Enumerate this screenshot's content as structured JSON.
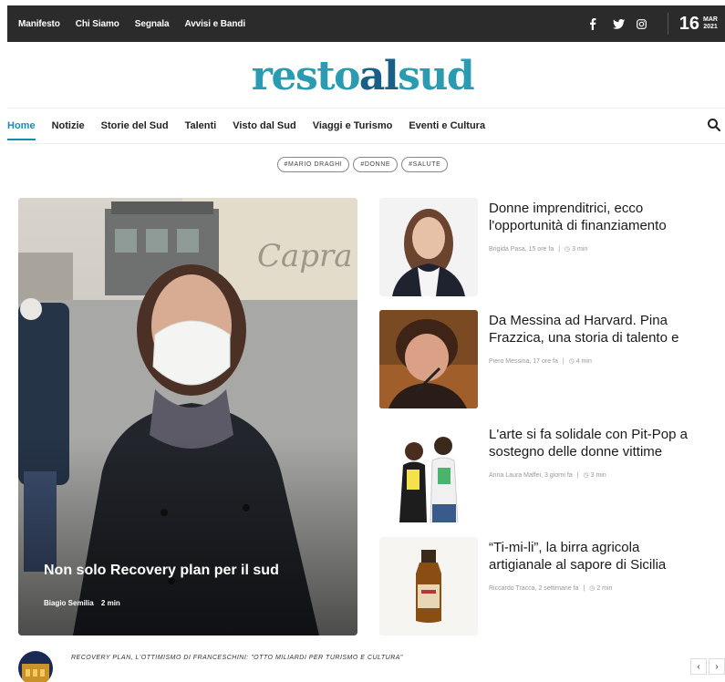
{
  "topbar": {
    "links": [
      "Manifesto",
      "Chi Siamo",
      "Segnala",
      "Avvisi e Bandi"
    ],
    "social_icons": [
      "facebook-icon",
      "twitter-icon",
      "instagram-icon"
    ],
    "date": {
      "day": "16",
      "month": "MAR",
      "year": "2021"
    }
  },
  "logo": {
    "part1": "resto",
    "part2": "al",
    "part3": "sud",
    "color_primary": "#2a9bb0",
    "color_secondary": "#1a5f86"
  },
  "nav": {
    "items": [
      "Home",
      "Notizie",
      "Storie del Sud",
      "Talenti",
      "Visto dal Sud",
      "Viaggi e Turismo",
      "Eventi e Cultura"
    ],
    "active_index": 0,
    "active_color": "#1a8bb0"
  },
  "tags": [
    "#MARIO DRAGHI",
    "#DONNE",
    "#SALUTE"
  ],
  "hero": {
    "title": "Non solo Recovery plan per il sud",
    "author": "Biagio Semilia",
    "read_time": "2 min"
  },
  "articles": [
    {
      "title_line1": "Donne imprenditrici, ecco",
      "title_line2": "l'opportunità di finanziamento",
      "author_time": "Brigida Pasa, 15 ore fa",
      "read_time": "3 min"
    },
    {
      "title_line1": "Da Messina ad Harvard. Pina",
      "title_line2": "Frazzica, una storia di talento e",
      "author_time": "Piero Messina, 17 ore fa",
      "read_time": "4 min"
    },
    {
      "title_line1": "L'arte si fa solidale con Pit-Pop a",
      "title_line2": "sostegno delle donne vittime",
      "author_time": "Anna Laura Maffei, 3 giorni fa",
      "read_time": "3 min"
    },
    {
      "title_line1": "“Ti-mi-li”, la birra agricola",
      "title_line2": "artigianale al sapore di Sicilia",
      "author_time": "Riccardo Tracca, 2 settimane fa",
      "read_time": "2 min"
    }
  ],
  "ticker": {
    "text": "RECOVERY PLAN, L'OTTIMISMO DI FRANCESCHINI: \"OTTO MILIARDI PER TURISMO E CULTURA\"",
    "prev": "‹",
    "next": "›"
  }
}
